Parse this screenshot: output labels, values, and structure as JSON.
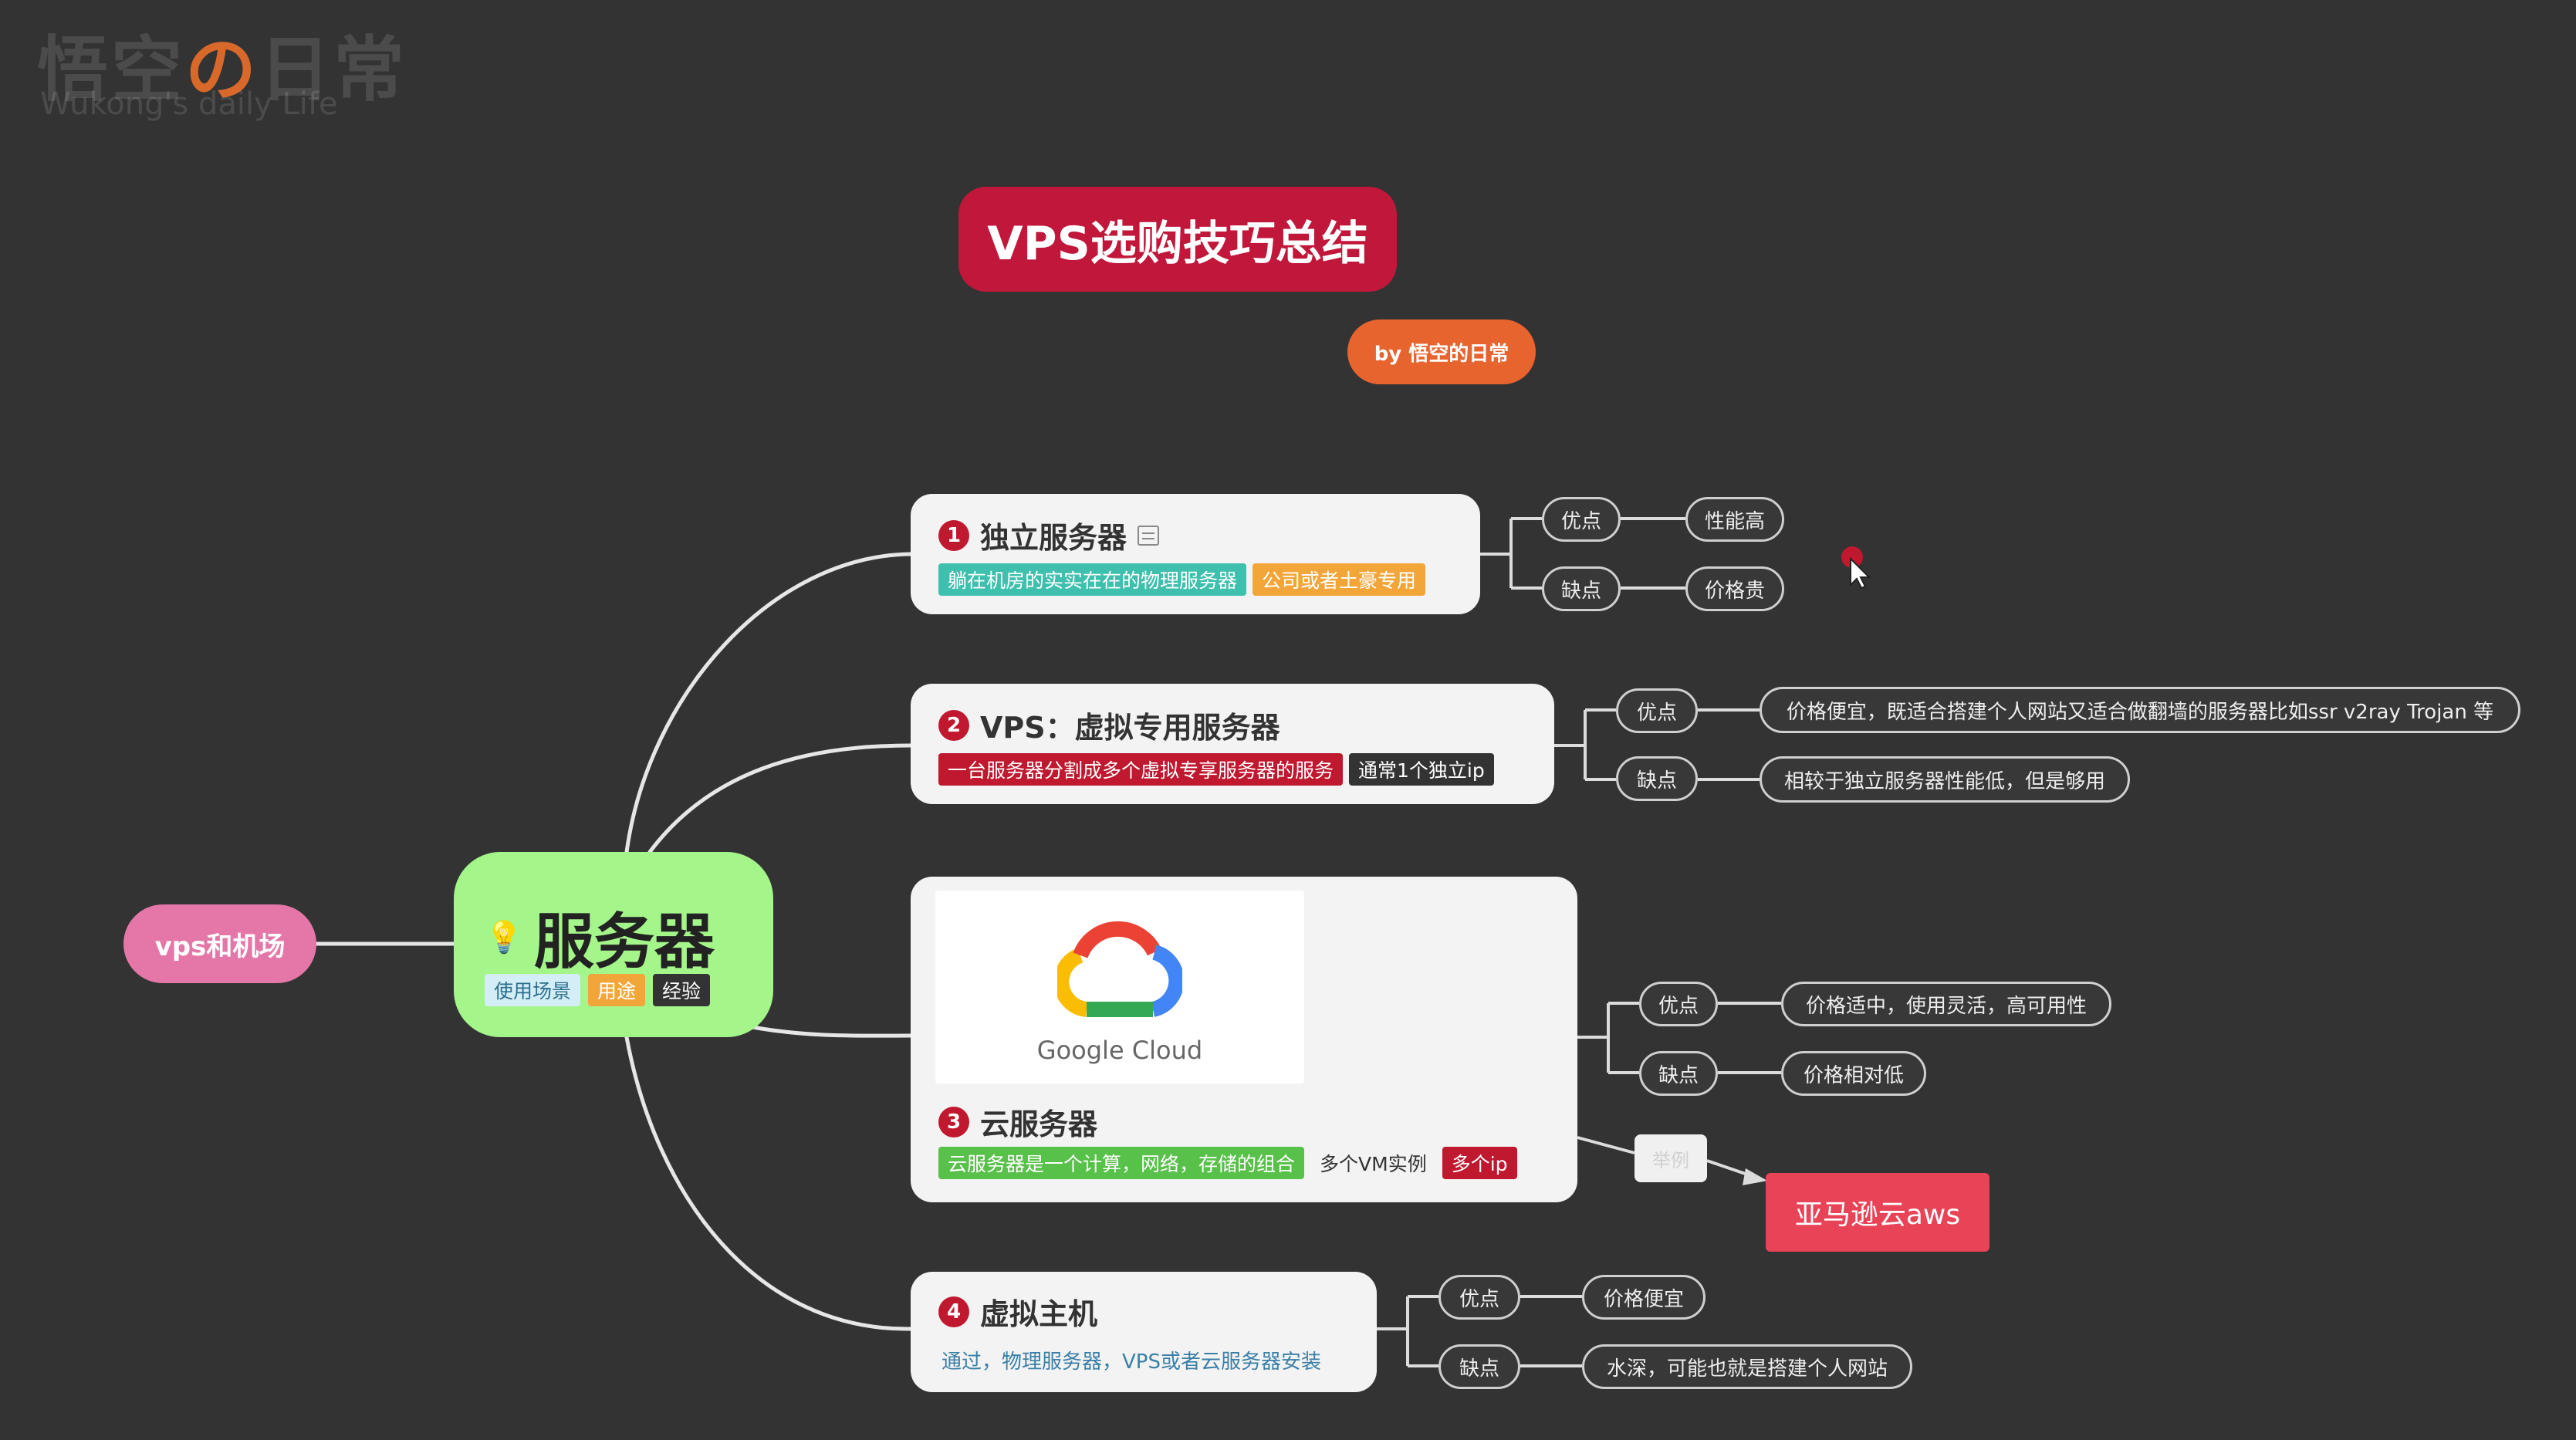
{
  "watermark": {
    "main_a": "悟空",
    "main_b": "の",
    "main_c": "日常",
    "sub": "Wukong's daily Life"
  },
  "title": "VPS选购技巧总结",
  "byline": "by 悟空的日常",
  "left_node": "vps和机场",
  "center": {
    "label": "服务器",
    "tags": [
      "使用场景",
      "用途",
      "经验"
    ]
  },
  "branches": [
    {
      "num": "1",
      "label": "独立服务器",
      "tags": [
        "躺在机房的实实在在的物理服务器",
        "公司或者土豪专用"
      ],
      "pros_label": "优点",
      "pros": "性能高",
      "cons_label": "缺点",
      "cons": "价格贵"
    },
    {
      "num": "2",
      "label": "VPS：虚拟专用服务器",
      "tags": [
        "一台服务器分割成多个虚拟专享服务器的服务",
        "通常1个独立ip"
      ],
      "pros_label": "优点",
      "pros": "价格便宜，既适合搭建个人网站又适合做翻墙的服务器比如ssr v2ray Trojan 等",
      "cons_label": "缺点",
      "cons": "相较于独立服务器性能低，但是够用"
    },
    {
      "num": "3",
      "label": "云服务器",
      "image_text": "Google Cloud",
      "tags": [
        "云服务器是一个计算，网络，存储的组合",
        "多个VM实例",
        "多个ip"
      ],
      "pros_label": "优点",
      "pros": "价格适中，使用灵活，高可用性",
      "cons_label": "缺点",
      "cons": "价格相对低",
      "example_label": "举例",
      "example": "亚马逊云aws"
    },
    {
      "num": "4",
      "label": "虚拟主机",
      "desc": "通过，物理服务器，VPS或者云服务器安装",
      "pros_label": "优点",
      "pros": "价格便宜",
      "cons_label": "缺点",
      "cons": "水深，可能也就是搭建个人网站"
    }
  ],
  "colors": {
    "background": "#333333",
    "title_bg": "#c0173a",
    "byline_bg": "#e8642e",
    "left_node_bg": "#e477a8",
    "center_bg": "#a4f58a",
    "aws_bg": "#e84356"
  }
}
